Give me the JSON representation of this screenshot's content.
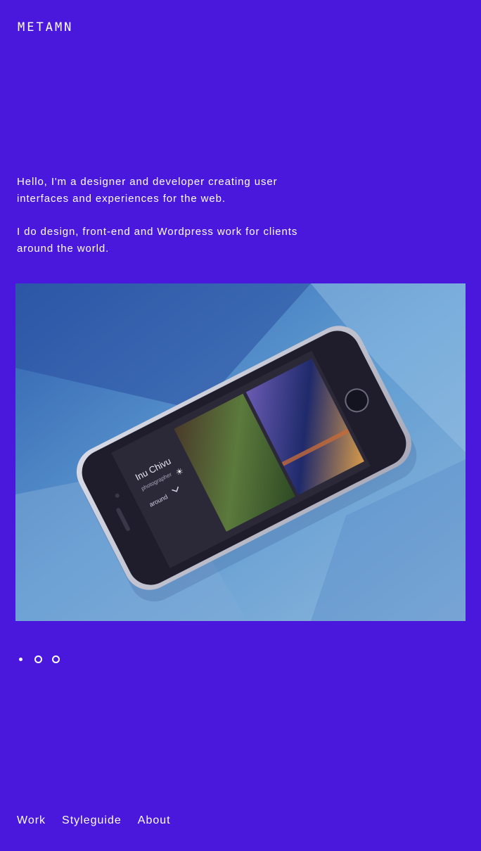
{
  "header": {
    "logo_text": "METAMN"
  },
  "intro": {
    "paragraph_1": "Hello, I'm a designer and developer creating user interfaces and experiences for the web.",
    "paragraph_2": "I do design, front-end and Wordpress work for clients around the world."
  },
  "hero": {
    "phone_screen": {
      "name": "Inu Chivu",
      "subtitle": "photographer",
      "nav_item": "around"
    }
  },
  "carousel": {
    "slide_count": 3,
    "active_index": 0
  },
  "footer": {
    "links": [
      "Work",
      "Styleguide",
      "About"
    ]
  },
  "colors": {
    "background": "#4a17dc",
    "text": "#ffffff"
  }
}
